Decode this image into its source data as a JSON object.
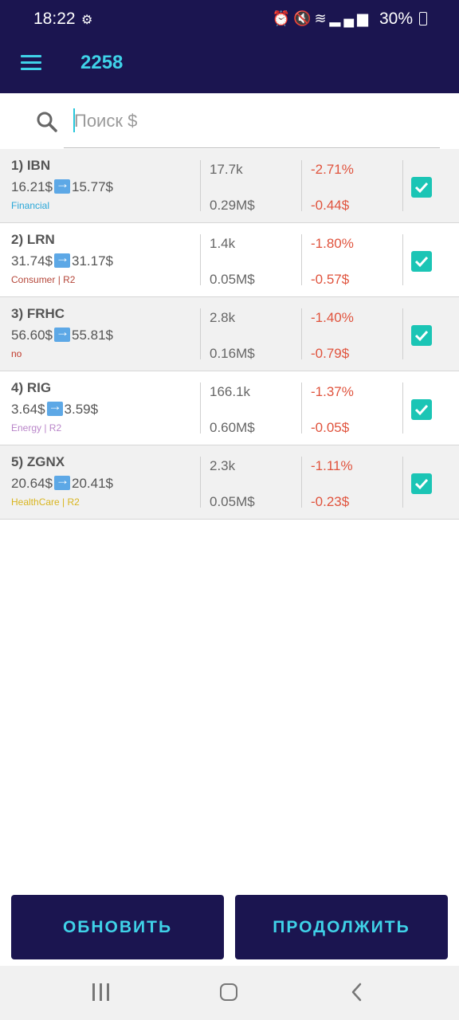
{
  "status_bar": {
    "time": "18:22",
    "battery": "30%",
    "icons": [
      "settings-gear-icon",
      "alarm-icon",
      "mute-icon",
      "wifi-icon",
      "signal-icon",
      "battery-icon"
    ]
  },
  "app_bar": {
    "title": "2258"
  },
  "search": {
    "placeholder": "Поиск $",
    "value": ""
  },
  "stocks": [
    {
      "ticker": "1) IBN",
      "price_from": "16.21$",
      "price_to": "15.77$",
      "sector": "Financial",
      "sector_color": "#2aa7d8",
      "volume": "17.7k",
      "cap": "0.29M$",
      "change_pct": "-2.71%",
      "change_usd": "-0.44$",
      "checked": true
    },
    {
      "ticker": "2) LRN",
      "price_from": "31.74$",
      "price_to": "31.17$",
      "sector": "Consumer | R2",
      "sector_color": "#b5473a",
      "volume": "1.4k",
      "cap": "0.05M$",
      "change_pct": "-1.80%",
      "change_usd": "-0.57$",
      "checked": true
    },
    {
      "ticker": "3) FRHC",
      "price_from": "56.60$",
      "price_to": "55.81$",
      "sector": "no",
      "sector_color": "#c0392b",
      "volume": "2.8k",
      "cap": "0.16M$",
      "change_pct": "-1.40%",
      "change_usd": "-0.79$",
      "checked": true
    },
    {
      "ticker": "4) RIG",
      "price_from": "3.64$",
      "price_to": "3.59$",
      "sector": "Energy | R2",
      "sector_color": "#b985c9",
      "volume": "166.1k",
      "cap": "0.60M$",
      "change_pct": "-1.37%",
      "change_usd": "-0.05$",
      "checked": true
    },
    {
      "ticker": "5) ZGNX",
      "price_from": "20.64$",
      "price_to": "20.41$",
      "sector": "HealthCare | R2",
      "sector_color": "#d9b51f",
      "volume": "2.3k",
      "cap": "0.05M$",
      "change_pct": "-1.11%",
      "change_usd": "-0.23$",
      "checked": true
    }
  ],
  "buttons": {
    "refresh": "ОБНОВИТЬ",
    "continue": "ПРОДОЛЖИТЬ"
  },
  "colors": {
    "primary": "#1b1550",
    "accent": "#3fd2e8",
    "negative": "#e0533d",
    "checkbox": "#1bc5b5"
  }
}
